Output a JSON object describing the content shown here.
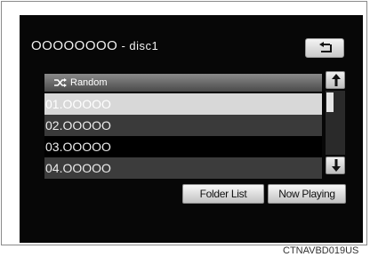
{
  "header": {
    "title": "OOOOOOOO",
    "title_suffix": " - disc1",
    "back_icon": "back-arrow-icon"
  },
  "list": {
    "random": {
      "icon": "shuffle-icon",
      "label": "Random"
    },
    "items": [
      {
        "label": "01.OOOOO",
        "selected": true
      },
      {
        "label": "02.OOOOO"
      },
      {
        "label": "03.OOOOO"
      },
      {
        "label": "04.OOOOO"
      }
    ]
  },
  "scrollbar": {
    "up_icon": "scroll-up-icon",
    "down_icon": "scroll-down-icon"
  },
  "buttons": {
    "folder_list": "Folder List",
    "now_playing": "Now Playing"
  },
  "caption": "CTNAVBD019US"
}
